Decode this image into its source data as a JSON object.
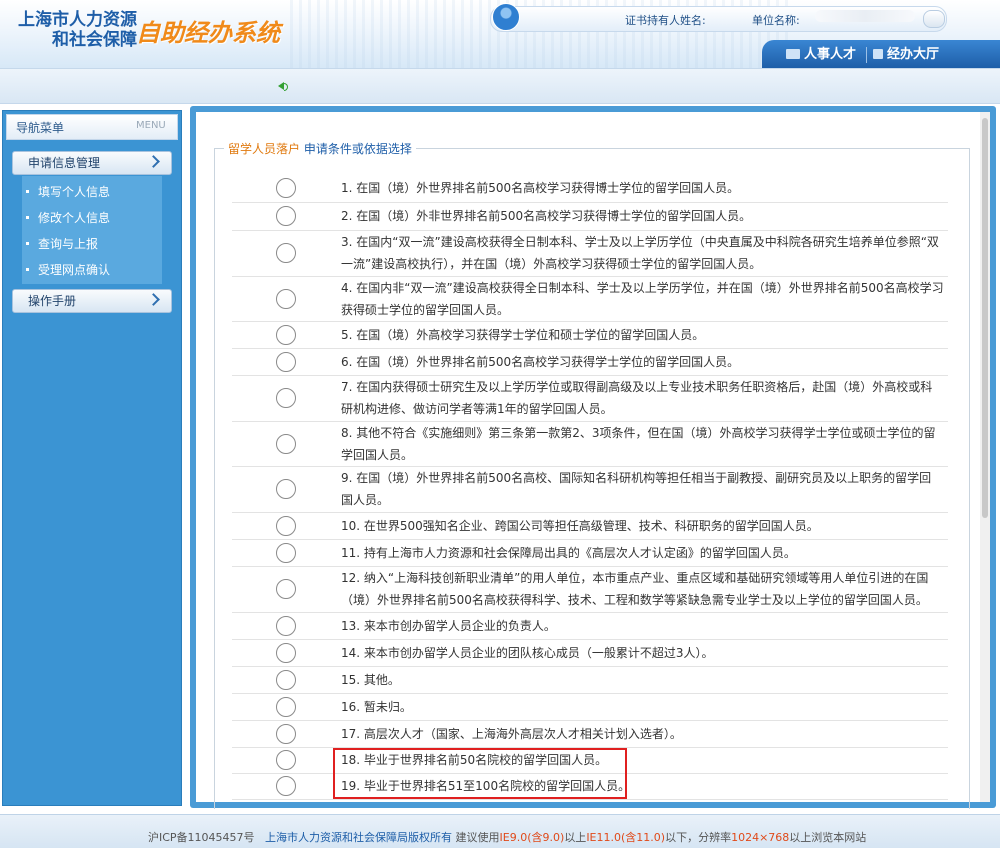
{
  "header": {
    "logo_line1": "上海市人力资源",
    "logo_line2": "和社会保障",
    "system_name": "自助经办系统",
    "holder_label": "证书持有人姓名:",
    "unit_label": "单位名称:",
    "tabs": [
      {
        "label": "人事人才"
      },
      {
        "label": "经办大厅"
      }
    ]
  },
  "sidebar": {
    "title": "导航菜单",
    "menu_label": "MENU",
    "sections": [
      {
        "label": "申请信息管理",
        "items": [
          "填写个人信息",
          "修改个人信息",
          "查询与上报",
          "受理网点确认"
        ]
      },
      {
        "label": "操作手册",
        "items": []
      }
    ]
  },
  "main": {
    "legend_part1": "留学人员落户",
    "legend_part2": " 申请条件或依据选择",
    "options": [
      {
        "line1": "1. 在国（境）外世界排名前500名高校学习获得博士学位的留学回国人员。",
        "line2": ""
      },
      {
        "line1": "2. 在国（境）外非世界排名前500名高校学习获得博士学位的留学回国人员。",
        "line2": ""
      },
      {
        "line1": "3. 在国内“双一流”建设高校获得全日制本科、学士及以上学历学位（中央直属及中科院各研究生培养单位参照“双",
        "line2": "一流”建设高校执行），并在国（境）外高校学习获得硕士学位的留学回国人员。"
      },
      {
        "line1": "4. 在国内非“双一流”建设高校获得全日制本科、学士及以上学历学位，并在国（境）外世界排名前500名高校学习",
        "line2": "获得硕士学位的留学回国人员。"
      },
      {
        "line1": "5. 在国（境）外高校学习获得学士学位和硕士学位的留学回国人员。",
        "line2": ""
      },
      {
        "line1": "6. 在国（境）外世界排名前500名高校学习获得学士学位的留学回国人员。",
        "line2": ""
      },
      {
        "line1": "7. 在国内获得硕士研究生及以上学历学位或取得副高级及以上专业技术职务任职资格后，赴国（境）外高校或科",
        "line2": "研机构进修、做访问学者等满1年的留学回国人员。"
      },
      {
        "line1": "8. 其他不符合《实施细则》第三条第一款第2、3项条件，但在国（境）外高校学习获得学士学位或硕士学位的留",
        "line2": "学回国人员。"
      },
      {
        "line1": "9. 在国（境）外世界排名前500名高校、国际知名科研机构等担任相当于副教授、副研究员及以上职务的留学回",
        "line2": "国人员。"
      },
      {
        "line1": "10. 在世界500强知名企业、跨国公司等担任高级管理、技术、科研职务的留学回国人员。",
        "line2": ""
      },
      {
        "line1": "11. 持有上海市人力资源和社会保障局出具的《高层次人才认定函》的留学回国人员。",
        "line2": ""
      },
      {
        "line1": "12. 纳入“上海科技创新职业清单”的用人单位，本市重点产业、重点区域和基础研究领域等用人单位引进的在国",
        "line2": "（境）外世界排名前500名高校获得科学、技术、工程和数学等紧缺急需专业学士及以上学位的留学回国人员。"
      },
      {
        "line1": "13. 来本市创办留学人员企业的负责人。",
        "line2": ""
      },
      {
        "line1": "14. 来本市创办留学人员企业的团队核心成员（一般累计不超过3人）。",
        "line2": ""
      },
      {
        "line1": "15. 其他。",
        "line2": ""
      },
      {
        "line1": "16. 暂未归。",
        "line2": ""
      },
      {
        "line1": "17. 高层次人才（国家、上海海外高层次人才相关计划入选者）。",
        "line2": ""
      },
      {
        "line1": "18. 毕业于世界排名前50名院校的留学回国人员。",
        "line2": ""
      },
      {
        "line1": "19. 毕业于世界排名51至100名院校的留学回国人员。",
        "line2": ""
      }
    ]
  },
  "footer": {
    "icp": "沪ICP备11045457号",
    "owner": "上海市人力资源和社会保障局版权所有",
    "t1": " 建议使用",
    "ie9": "IE9.0(含9.0)",
    "t2": "以上",
    "ie11": "IE11.0(含11.0)",
    "t3": "以下，分辨率",
    "res": "1024×768",
    "t4": "以上浏览本网站"
  },
  "colors": {
    "brand_blue": "#1e5ea8",
    "accent_orange": "#f08a1a",
    "sidebar_blue": "#3b94d3",
    "highlight_red": "#e02020"
  }
}
